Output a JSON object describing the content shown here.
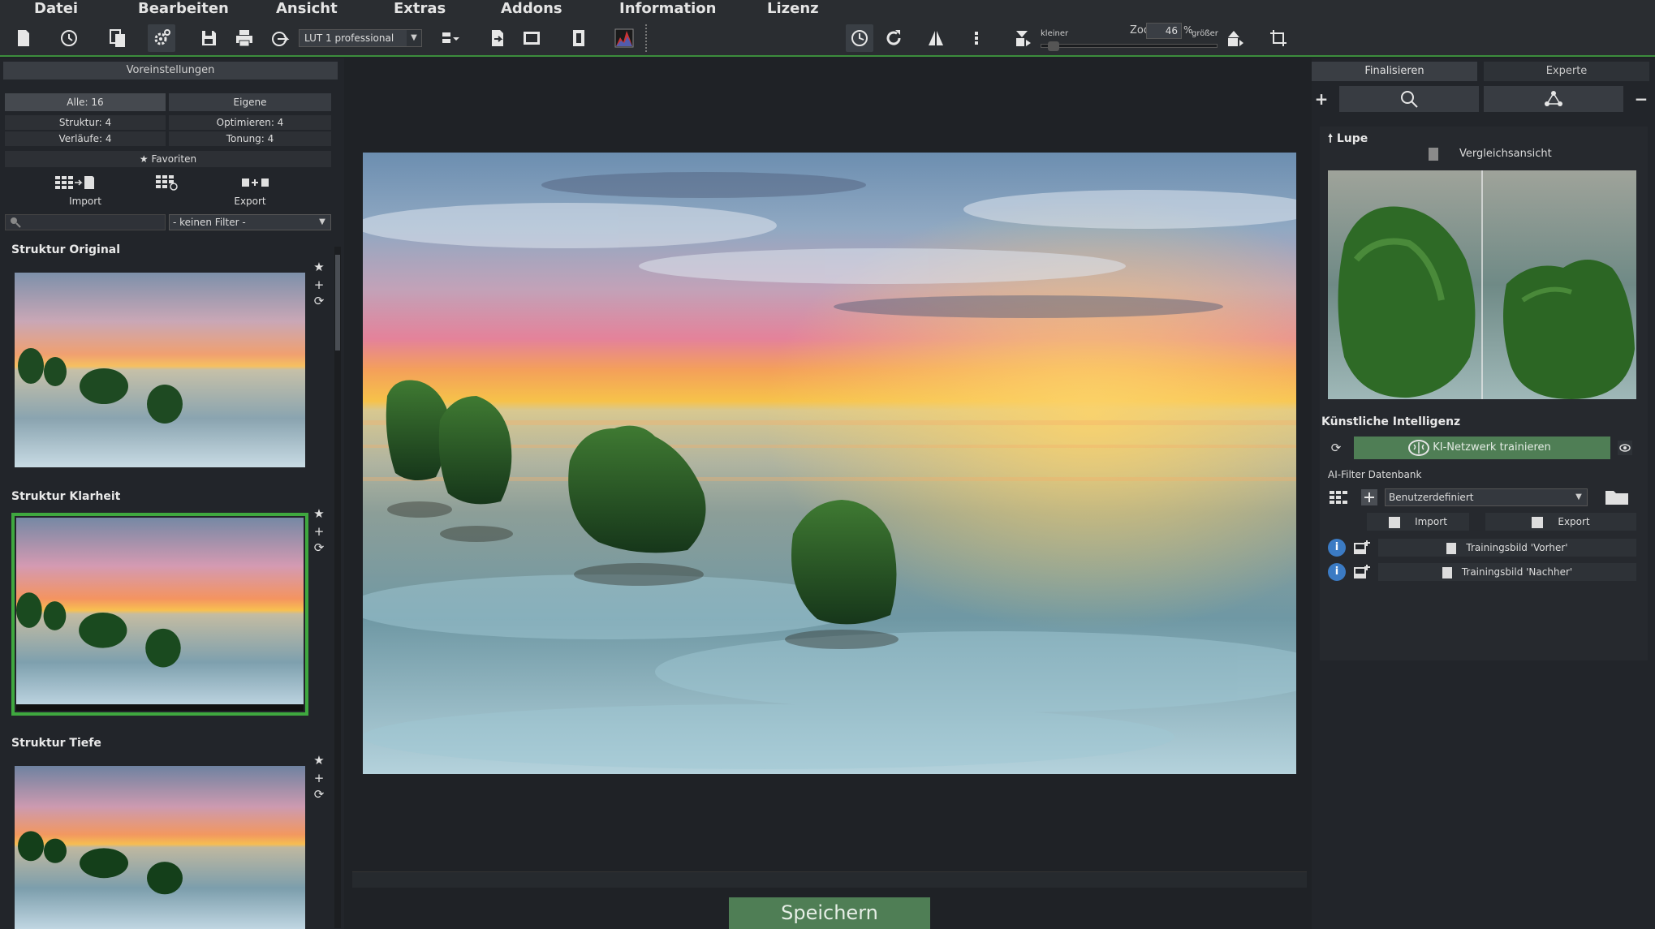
{
  "menu": [
    "Datei",
    "Bearbeiten",
    "Ansicht",
    "Extras",
    "Addons",
    "Information",
    "Lizenz"
  ],
  "toolbar": {
    "lut_select": "LUT 1 professional",
    "zoom_title": "Zoo",
    "zoom_value": "46",
    "zoom_pct": "%",
    "zoom_smaller": "kleiner",
    "zoom_larger": "größer",
    "zoom_level": 0.04
  },
  "left": {
    "header": "Voreinstellungen",
    "tab_all": "Alle: 16",
    "tab_own": "Eigene",
    "stat_struktur": "Struktur: 4",
    "stat_optimieren": "Optimieren: 4",
    "stat_verlaeufe": "Verläufe: 4",
    "stat_tonung": "Tonung: 4",
    "favorites": "★ Favoriten",
    "import_label": "Import",
    "export_label": "Export",
    "filter_select": "- keinen Filter -",
    "presets": [
      {
        "title": "Struktur Original"
      },
      {
        "title": "Struktur Klarheit"
      },
      {
        "title": "Struktur Tiefe"
      }
    ]
  },
  "center": {
    "save_label": "Speichern"
  },
  "right": {
    "tab_finalize": "Finalisieren",
    "tab_expert": "Experte",
    "lupe_title": "🠕 Lupe",
    "compare_label": "Vergleichsansicht",
    "ki_title": "Künstliche Intelligenz",
    "ki_train": "KI-Netzwerk trainieren",
    "ai_db_label": "AI-Filter Datenbank",
    "db_select": "Benutzerdefiniert",
    "import_label": "Import",
    "export_label": "Export",
    "train_before": "Trainingsbild 'Vorher'",
    "train_after": "Trainingsbild 'Nachher'"
  },
  "colors": {
    "accent_green": "#3fa83f",
    "button_green": "#4f7e55",
    "info_blue": "#3b7bc4"
  }
}
